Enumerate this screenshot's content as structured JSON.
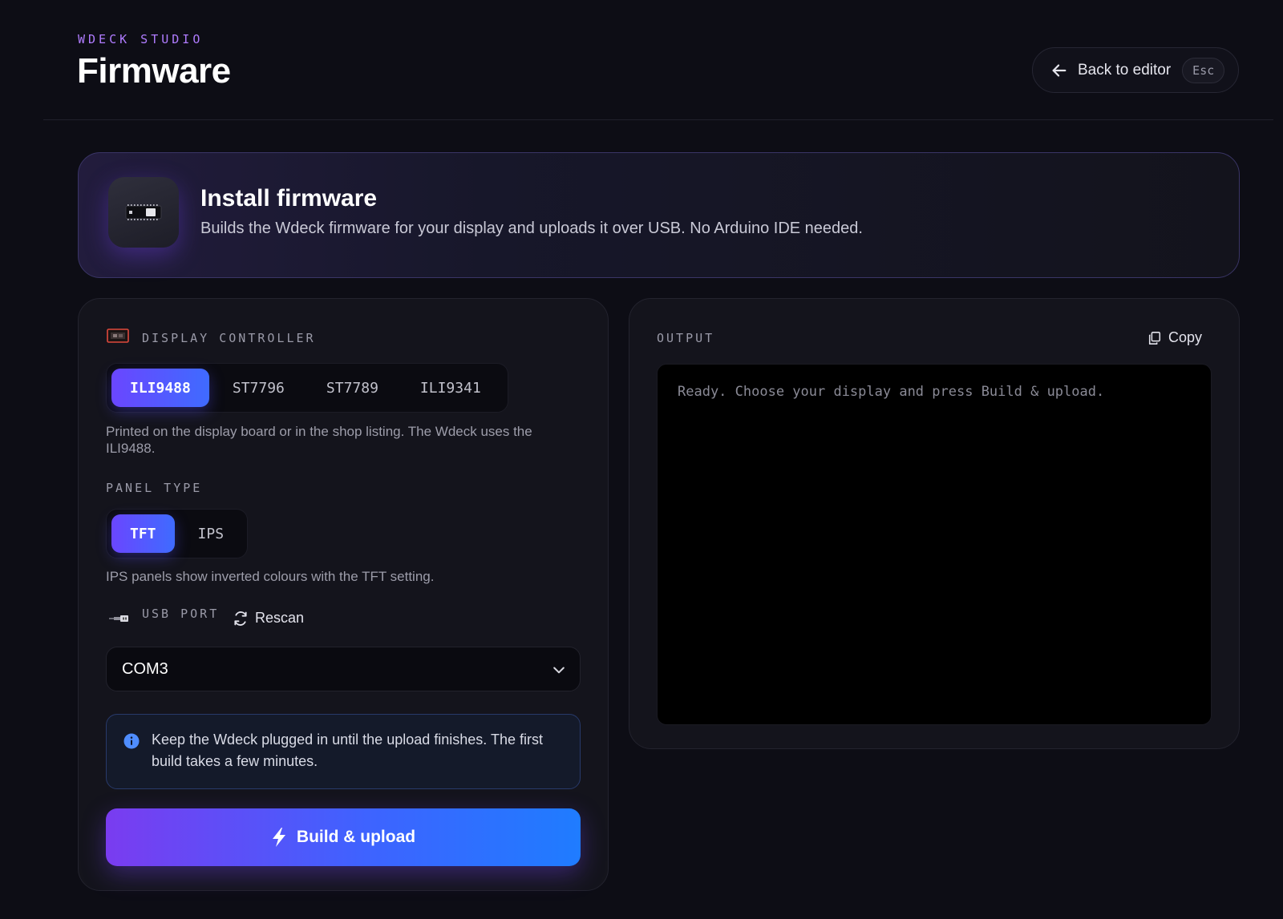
{
  "header": {
    "brand": "WDECK STUDIO",
    "title": "Firmware",
    "back_label": "Back to editor",
    "back_shortcut": "Esc"
  },
  "banner": {
    "title": "Install firmware",
    "description": "Builds the Wdeck firmware for your display and uploads it over USB. No Arduino IDE needed."
  },
  "display_controller": {
    "label": "DISPLAY CONTROLLER",
    "options": [
      "ILI9488",
      "ST7796",
      "ST7789",
      "ILI9341"
    ],
    "selected": "ILI9488",
    "hint": "Printed on the display board or in the shop listing. The Wdeck uses the ILI9488."
  },
  "panel_type": {
    "label": "PANEL TYPE",
    "options": [
      "TFT",
      "IPS"
    ],
    "selected": "TFT",
    "hint": "IPS panels show inverted colours with the TFT setting."
  },
  "usb_port": {
    "label": "USB PORT",
    "rescan_label": "Rescan",
    "selected": "COM3"
  },
  "notice": {
    "text": "Keep the Wdeck plugged in until the upload finishes. The first build takes a few minutes."
  },
  "build_button": {
    "label": "Build & upload"
  },
  "output": {
    "label": "OUTPUT",
    "copy_label": "Copy",
    "text": "Ready. Choose your display and press Build & upload."
  },
  "icons": {
    "back": "arrow-left-icon",
    "banner": "microcontroller-board-icon",
    "display": "display-icon",
    "usb": "usb-plug-icon",
    "rescan": "refresh-icon",
    "chevron": "chevron-down-icon",
    "info": "info-icon",
    "bolt": "lightning-bolt-icon",
    "copy": "copy-icon"
  },
  "colors": {
    "accent_purple": "#6a46ff",
    "accent_blue": "#1f7cff",
    "brand_label": "#b07cff",
    "info_blue": "#4f8dff",
    "display_icon_red": "#e0493c"
  }
}
